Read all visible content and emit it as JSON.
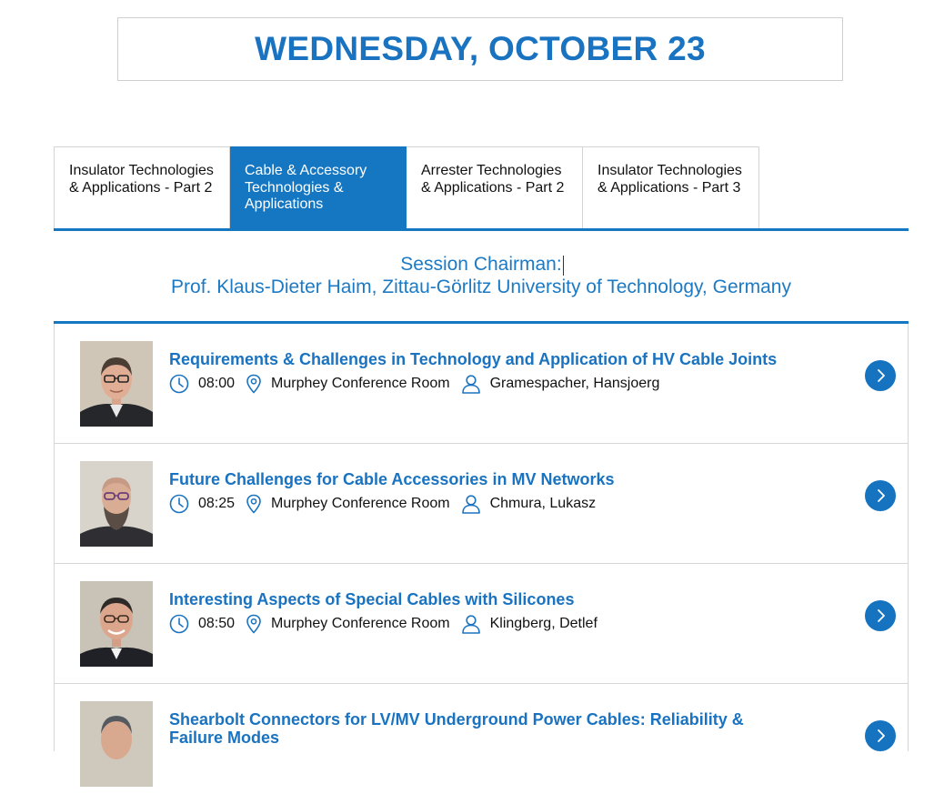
{
  "day": {
    "title": "WEDNESDAY, OCTOBER 23"
  },
  "tabs": [
    {
      "label": "Insulator Technologies & Applications - Part 2",
      "active": false
    },
    {
      "label": "Cable & Accessory Technologies & Applications",
      "active": true
    },
    {
      "label": "Arrester Technologies & Applications - Part 2",
      "active": false
    },
    {
      "label": "Insulator Technologies & Applications - Part 3",
      "active": false
    }
  ],
  "chairman": {
    "label": "Session Chairman:",
    "name": "Prof. Klaus-Dieter Haim, Zittau-Görlitz University of Technology, Germany"
  },
  "sessions": [
    {
      "title": "Requirements & Challenges in Technology and Application of HV Cable Joints",
      "time": "08:00",
      "room": "Murphey Conference Room",
      "speaker": "Gramespacher, Hansjoerg"
    },
    {
      "title": "Future Challenges for Cable Accessories in MV Networks",
      "time": "08:25",
      "room": "Murphey Conference Room",
      "speaker": "Chmura, Lukasz"
    },
    {
      "title": "Interesting Aspects of Special Cables with Silicones",
      "time": "08:50",
      "room": "Murphey Conference Room",
      "speaker": "Klingberg, Detlef"
    },
    {
      "title": "Shearbolt Connectors for LV/MV Underground Power Cables: Reliability & Failure Modes",
      "time": "",
      "room": "",
      "speaker": ""
    }
  ],
  "icons": {
    "time": "clock-icon",
    "room": "location-pin-icon",
    "speaker": "person-icon",
    "open": "chevron-right-icon"
  },
  "colors": {
    "accent": "#1577c2",
    "title": "#1a73c0"
  }
}
